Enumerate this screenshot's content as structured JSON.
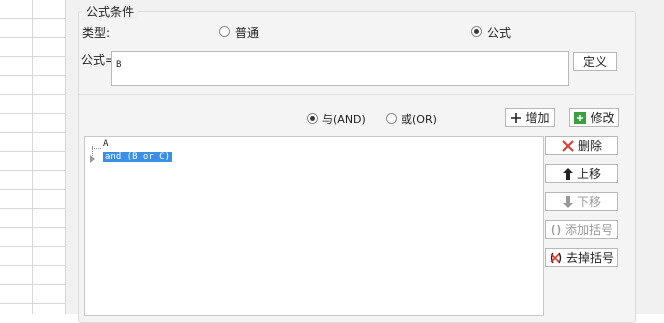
{
  "group_title": "公式条件",
  "type_label": "类型:",
  "type_options": [
    {
      "label": "普通",
      "selected": false
    },
    {
      "label": "公式",
      "selected": true
    }
  ],
  "formula_label": "公式=",
  "formula_value": "B",
  "define_button": "定义",
  "logic_options": [
    {
      "label": "与(AND)",
      "selected": true
    },
    {
      "label": "或(OR)",
      "selected": false
    }
  ],
  "add_button": "增加",
  "modify_button": "修改",
  "tree_items": [
    {
      "text": "A",
      "selected": false
    },
    {
      "text": "and (B or C)",
      "selected": true
    }
  ],
  "side_buttons": {
    "delete": "删除",
    "move_up": "上移",
    "move_down": "下移",
    "add_bracket": "添加括号",
    "remove_bracket": "去掉括号"
  },
  "colors": {
    "selection": "#3b8fe6",
    "delete_icon": "#e03a2f",
    "modify_icon": "#3aa142"
  }
}
